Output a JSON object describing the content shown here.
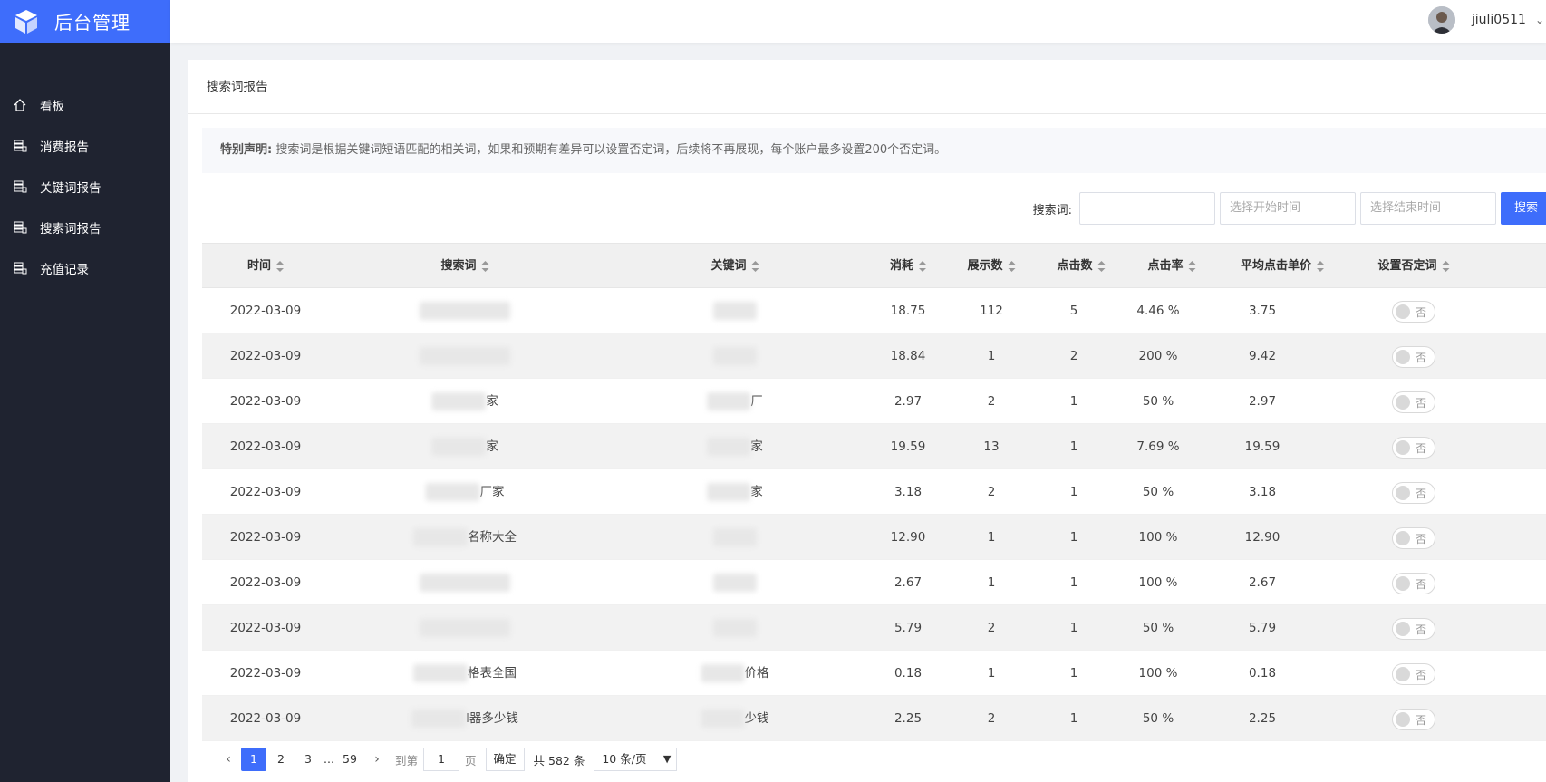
{
  "app": {
    "title": "后台管理"
  },
  "sidebar": {
    "items": [
      {
        "label": "看板",
        "icon": "home-icon"
      },
      {
        "label": "消费报告",
        "icon": "database-icon"
      },
      {
        "label": "关键词报告",
        "icon": "database-icon"
      },
      {
        "label": "搜索词报告",
        "icon": "database-icon"
      },
      {
        "label": "充值记录",
        "icon": "database-icon"
      }
    ]
  },
  "header": {
    "username": "jiuli0511"
  },
  "page": {
    "title": "搜索词报告",
    "notice_label": "特别声明:",
    "notice_text": "搜索词是根据关键词短语匹配的相关词，如果和预期有差异可以设置否定词，后续将不再展现，每个账户最多设置200个否定词。"
  },
  "filters": {
    "search_label": "搜索词:",
    "keyword_value": "",
    "start_placeholder": "选择开始时间",
    "end_placeholder": "选择结束时间",
    "search_button": "搜索"
  },
  "table": {
    "columns": [
      "时间",
      "搜索词",
      "关键词",
      "消耗",
      "展示数",
      "点击数",
      "点击率",
      "平均点击单价",
      "设置否定词"
    ],
    "rows": [
      {
        "date": "2022-03-09",
        "term": "",
        "keyword": "",
        "cost": "18.75",
        "impr": "112",
        "clicks": "5",
        "ctr": "4.46 %",
        "cpc": "3.75",
        "neg": "否"
      },
      {
        "date": "2022-03-09",
        "term": "",
        "keyword": "",
        "cost": "18.84",
        "impr": "1",
        "clicks": "2",
        "ctr": "200 %",
        "cpc": "9.42",
        "neg": "否"
      },
      {
        "date": "2022-03-09",
        "term": "家",
        "keyword": "厂",
        "cost": "2.97",
        "impr": "2",
        "clicks": "1",
        "ctr": "50 %",
        "cpc": "2.97",
        "neg": "否"
      },
      {
        "date": "2022-03-09",
        "term": "家",
        "keyword": "家",
        "cost": "19.59",
        "impr": "13",
        "clicks": "1",
        "ctr": "7.69 %",
        "cpc": "19.59",
        "neg": "否"
      },
      {
        "date": "2022-03-09",
        "term": "厂家",
        "keyword": "家",
        "cost": "3.18",
        "impr": "2",
        "clicks": "1",
        "ctr": "50 %",
        "cpc": "3.18",
        "neg": "否"
      },
      {
        "date": "2022-03-09",
        "term": "名称大全",
        "keyword": "",
        "cost": "12.90",
        "impr": "1",
        "clicks": "1",
        "ctr": "100 %",
        "cpc": "12.90",
        "neg": "否"
      },
      {
        "date": "2022-03-09",
        "term": "",
        "keyword": "",
        "cost": "2.67",
        "impr": "1",
        "clicks": "1",
        "ctr": "100 %",
        "cpc": "2.67",
        "neg": "否"
      },
      {
        "date": "2022-03-09",
        "term": "",
        "keyword": "",
        "cost": "5.79",
        "impr": "2",
        "clicks": "1",
        "ctr": "50 %",
        "cpc": "5.79",
        "neg": "否"
      },
      {
        "date": "2022-03-09",
        "term": "格表全国",
        "keyword": "价格",
        "cost": "0.18",
        "impr": "1",
        "clicks": "1",
        "ctr": "100 %",
        "cpc": "0.18",
        "neg": "否"
      },
      {
        "date": "2022-03-09",
        "term": "l器多少钱",
        "keyword": "少钱",
        "cost": "2.25",
        "impr": "2",
        "clicks": "1",
        "ctr": "50 %",
        "cpc": "2.25",
        "neg": "否"
      }
    ]
  },
  "pagination": {
    "pages": [
      "1",
      "2",
      "3",
      "...",
      "59"
    ],
    "current": "1",
    "goto_label": "到第",
    "goto_value": "1",
    "page_suffix": "页",
    "confirm": "确定",
    "total": "共 582 条",
    "page_size": "10 条/页"
  },
  "colors": {
    "accent": "#3e6dfb",
    "sidebar_bg": "#1f2330"
  }
}
